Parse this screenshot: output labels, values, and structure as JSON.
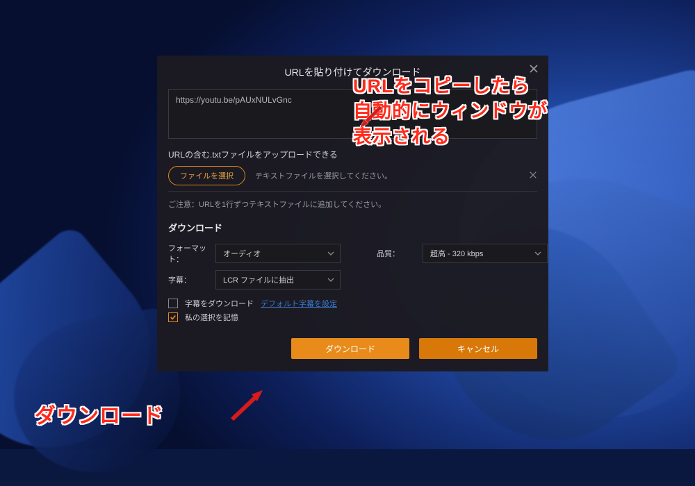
{
  "dialog": {
    "title": "URLを貼り付けてダウンロード",
    "url_value": "https://youtu.be/pAUxNULvGnc",
    "upload_section_label": "URLの含む.txtファイルをアップロードできる",
    "file_select_label": "ファイルを選択",
    "file_hint": "テキストファイルを選択してください。",
    "note": "ご注意：URLを1行ずつテキストファイルに追加してください。",
    "download_heading": "ダウンロード",
    "format_label": "フォーマット：",
    "format_value": "オーディオ",
    "quality_label": "品質：",
    "quality_value": "超高 - 320 kbps",
    "subtitle_label": "字幕：",
    "subtitle_value": "LCR ファイルに抽出",
    "download_subtitle_check": "字幕をダウンロード",
    "default_subtitle_link": "デフォルト字幕を設定",
    "remember_check": "私の選択を記憶",
    "download_btn": "ダウンロード",
    "cancel_btn": "キャンセル"
  },
  "annotations": {
    "top_line1": "URLをコピーしたら",
    "top_line2": "自動的にウィンドウが",
    "top_line3": "表示される",
    "bottom": "ダウンロード"
  }
}
